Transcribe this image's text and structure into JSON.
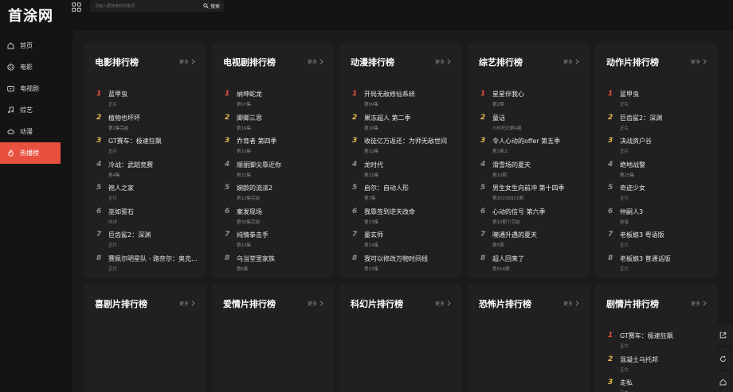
{
  "app": {
    "logo": "首涂网"
  },
  "search": {
    "placeholder": "请输入要搜索的关键词",
    "button_label": "搜索"
  },
  "sidebar": {
    "items": [
      {
        "label": "首页",
        "icon": "home-icon",
        "active": false
      },
      {
        "label": "电影",
        "icon": "film-reel-icon",
        "active": false
      },
      {
        "label": "电视剧",
        "icon": "tv-icon",
        "active": false
      },
      {
        "label": "综艺",
        "icon": "music-note-icon",
        "active": false
      },
      {
        "label": "动漫",
        "icon": "cloud-icon",
        "active": false
      },
      {
        "label": "热播榜",
        "icon": "flame-icon",
        "active": true
      }
    ]
  },
  "colors": {
    "accent": "#e8503f",
    "gold": "#e8b84f",
    "background": "#141414",
    "card": "#202020"
  },
  "more_label": "更多",
  "top_cards": [
    {
      "title": "电影排行榜",
      "items": [
        {
          "name": "蓝甲虫",
          "sub": "正片"
        },
        {
          "name": "植物也坏坏",
          "sub": "第2集完结"
        },
        {
          "name": "GT赛车：极速狂飙",
          "sub": "正片"
        },
        {
          "name": "冷战：武蹈竞赛",
          "sub": "第4集"
        },
        {
          "name": "袍人之家",
          "sub": "正片"
        },
        {
          "name": "巫如誓石",
          "sub": "内详"
        },
        {
          "name": "巨齿鲨2：深渊",
          "sub": "正片"
        },
        {
          "name": "赛佩尔明星队 - 路奈尔：奥克...",
          "sub": "正片"
        }
      ]
    },
    {
      "title": "电视剧排行榜",
      "items": [
        {
          "name": "纳坤蛇龙",
          "sub": "第07集"
        },
        {
          "name": "卿卿三思",
          "sub": "第16集"
        },
        {
          "name": "乔育者 第四季",
          "sub": "第10集"
        },
        {
          "name": "顺丽脚尖靠近你",
          "sub": "第21集"
        },
        {
          "name": "婉龄的流派2",
          "sub": "第12集完结"
        },
        {
          "name": "案发现场",
          "sub": "第30集完结"
        },
        {
          "name": "纯情拳击手",
          "sub": "第10集"
        },
        {
          "name": "乌当堂里家族",
          "sub": "第6集"
        }
      ]
    },
    {
      "title": "动漫排行榜",
      "items": [
        {
          "name": "开局无敌修仙系统",
          "sub": "第99集"
        },
        {
          "name": "果冻超人 第二季",
          "sub": "第16集"
        },
        {
          "name": "收徒亿万返还：为师无敌世间",
          "sub": "第32集"
        },
        {
          "name": "龙时代",
          "sub": "第11集"
        },
        {
          "name": "启尔：自动人形",
          "sub": "第7集"
        },
        {
          "name": "我靠签到逆天改命",
          "sub": "第33集"
        },
        {
          "name": "墨玄师",
          "sub": "第14集"
        },
        {
          "name": "我可以修改万物时间线",
          "sub": "第33集"
        }
      ]
    },
    {
      "title": "综艺排行榜",
      "items": [
        {
          "name": "星星伴我心",
          "sub": "第2期"
        },
        {
          "name": "童话",
          "sub": "小村托记第4期"
        },
        {
          "name": "令人心动的offer 第五季",
          "sub": "第1期上"
        },
        {
          "name": "滑雪场的夏天",
          "sub": "第10期"
        },
        {
          "name": "男生女生向前冲 第十四季",
          "sub": "第20230921期"
        },
        {
          "name": "心动的信号 第六季",
          "sub": "第10期下完结"
        },
        {
          "name": "噢通升遇的夏天",
          "sub": "第5期"
        },
        {
          "name": "超人回来了",
          "sub": "第504期"
        }
      ]
    },
    {
      "title": "动作片排行榜",
      "items": [
        {
          "name": "蓝甲虫",
          "sub": "正片"
        },
        {
          "name": "巨齿鲨2：深渊",
          "sub": "正片"
        },
        {
          "name": "决战资户谷",
          "sub": "正片"
        },
        {
          "name": "绝地战警",
          "sub": "第25集"
        },
        {
          "name": "奇迹少女",
          "sub": "正片"
        },
        {
          "name": "仲嗣人3",
          "sub": "抢版"
        },
        {
          "name": "老板娘3 粤语版",
          "sub": "正片"
        },
        {
          "name": "老板娘3 普通话版",
          "sub": "正片"
        }
      ]
    }
  ],
  "bottom_cards": [
    {
      "title": "喜剧片排行榜",
      "items": []
    },
    {
      "title": "爱情片排行榜",
      "items": []
    },
    {
      "title": "科幻片排行榜",
      "items": []
    },
    {
      "title": "恐怖片排行榜",
      "items": []
    },
    {
      "title": "剧情片排行榜",
      "items": [
        {
          "name": "GT赛车：极速狂飙",
          "sub": "正片"
        },
        {
          "name": "混凝土乌托邦",
          "sub": "正片"
        },
        {
          "name": "走私",
          "sub": "正片"
        }
      ]
    }
  ]
}
